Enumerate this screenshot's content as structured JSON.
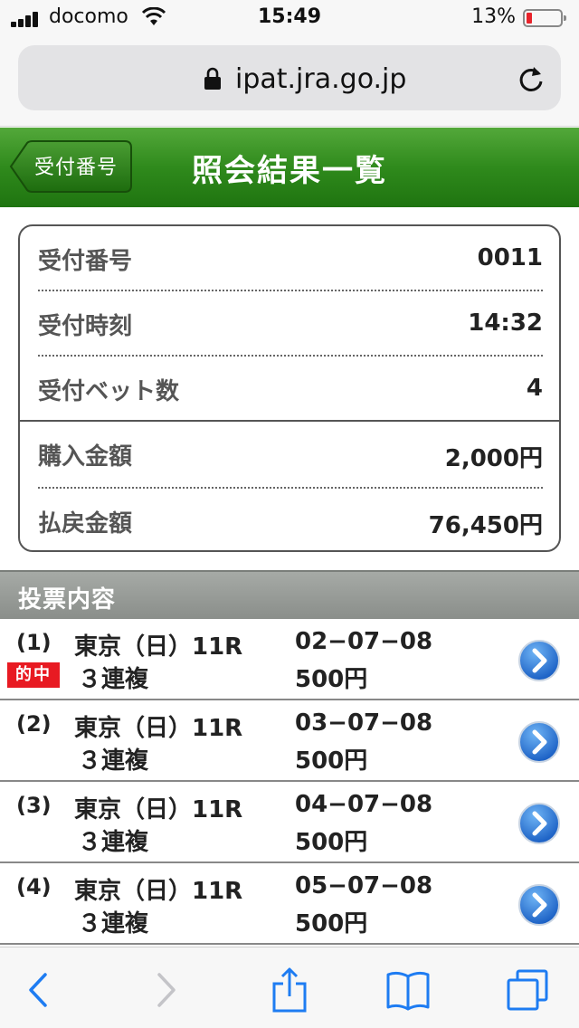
{
  "status_bar": {
    "carrier": "docomo",
    "time": "15:49",
    "battery_percent": "13%",
    "battery_level": 0.13
  },
  "browser": {
    "url": "ipat.jra.go.jp"
  },
  "header": {
    "back_label": "受付番号",
    "title": "照会結果一覧",
    "accent_color": "#2f8a1c"
  },
  "summary": {
    "rows": [
      {
        "label": "受付番号",
        "value": "0011"
      },
      {
        "label": "受付時刻",
        "value": "14:32"
      },
      {
        "label": "受付ベット数",
        "value": "4"
      },
      {
        "label": "購入金額",
        "value": "2,000円"
      },
      {
        "label": "払戻金額",
        "value": "76,450円"
      }
    ]
  },
  "bets": {
    "section_title": "投票内容",
    "hit_label": "的中",
    "items": [
      {
        "no": "(1)",
        "race": "東京（日）11R",
        "type": "３連複",
        "combo": "02−07−08",
        "amount": "500円",
        "hit": true
      },
      {
        "no": "(2)",
        "race": "東京（日）11R",
        "type": "３連複",
        "combo": "03−07−08",
        "amount": "500円",
        "hit": false
      },
      {
        "no": "(3)",
        "race": "東京（日）11R",
        "type": "３連複",
        "combo": "04−07−08",
        "amount": "500円",
        "hit": false
      },
      {
        "no": "(4)",
        "race": "東京（日）11R",
        "type": "３連複",
        "combo": "05−07−08",
        "amount": "500円",
        "hit": false
      }
    ]
  },
  "toolbar": {
    "icons": [
      "back-icon",
      "forward-icon",
      "share-icon",
      "bookmarks-icon",
      "tabs-icon"
    ]
  }
}
